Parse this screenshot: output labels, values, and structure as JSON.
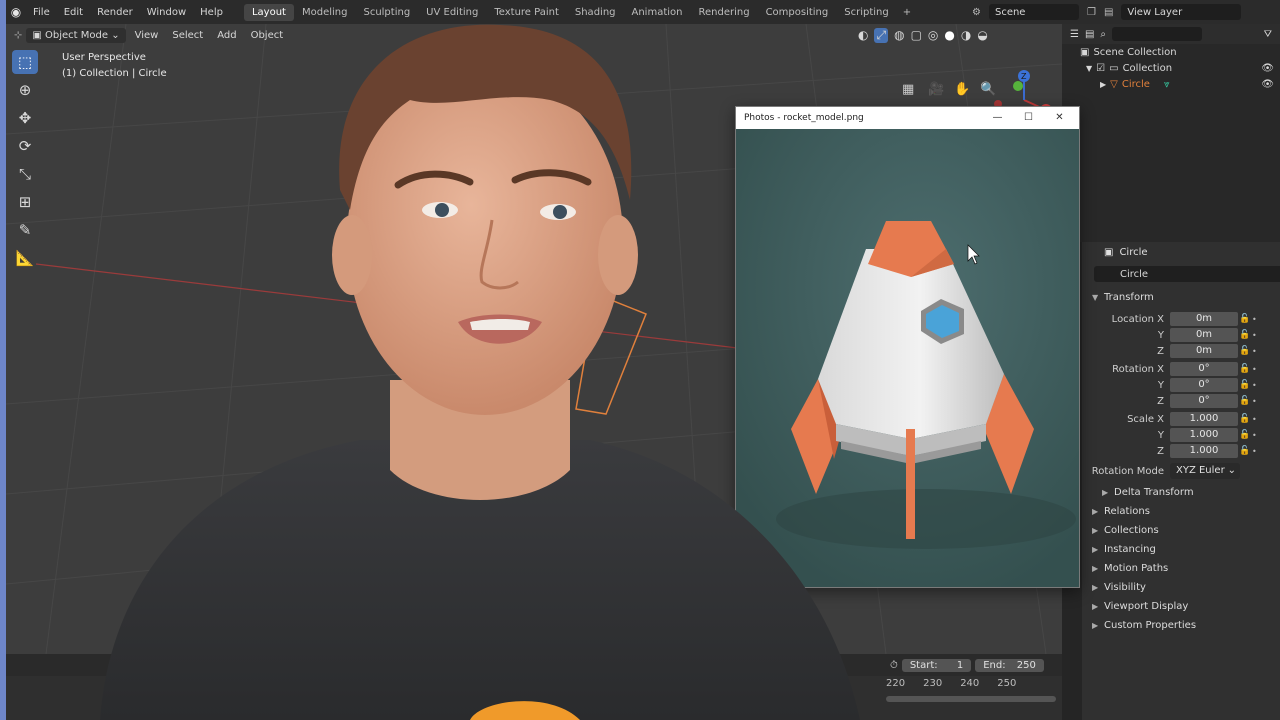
{
  "app": {
    "menu": [
      "File",
      "Edit",
      "Render",
      "Window",
      "Help"
    ],
    "workspaces": [
      "Layout",
      "Modeling",
      "Sculpting",
      "UV Editing",
      "Texture Paint",
      "Shading",
      "Animation",
      "Rendering",
      "Compositing",
      "Scripting"
    ],
    "active_workspace": "Layout",
    "add_workspace": "+",
    "scene": "Scene",
    "view_layer": "View Layer"
  },
  "viewport": {
    "mode": "Object Mode",
    "menus": [
      "View",
      "Select",
      "Add",
      "Object"
    ],
    "perspective": "User Perspective",
    "collection_info": "(1) Collection | Circle",
    "gizmo": {
      "x": "X",
      "y": "Y",
      "z": "Z"
    }
  },
  "outliner": {
    "scene_collection": "Scene Collection",
    "collection": "Collection",
    "object": "Circle"
  },
  "properties": {
    "object_name": "Circle",
    "field_name": "Circle",
    "transform_title": "Transform",
    "location": {
      "label_x": "Location X",
      "label_y": "Y",
      "label_z": "Z",
      "x": "0m",
      "y": "0m",
      "z": "0m"
    },
    "rotation": {
      "label_x": "Rotation X",
      "label_y": "Y",
      "label_z": "Z",
      "x": "0°",
      "y": "0°",
      "z": "0°"
    },
    "scale": {
      "label_x": "Scale X",
      "label_y": "Y",
      "label_z": "Z",
      "x": "1.000",
      "y": "1.000",
      "z": "1.000"
    },
    "rotation_mode_label": "Rotation Mode",
    "rotation_mode": "XYZ Euler",
    "delta_transform": "Delta Transform",
    "sections": [
      "Relations",
      "Collections",
      "Instancing",
      "Motion Paths",
      "Visibility",
      "Viewport Display",
      "Custom Properties"
    ]
  },
  "timeline": {
    "start_label": "Start:",
    "start": "1",
    "end_label": "End:",
    "end": "250",
    "ruler": [
      "220",
      "230",
      "240",
      "250"
    ]
  },
  "photos_window": {
    "title": "Photos - rocket_model.png",
    "minimize": "—",
    "maximize": "☐",
    "close": "✕"
  },
  "colors": {
    "accent": "#4772b3",
    "object_orange": "#e0803c",
    "photo_bg": "#3f5d5e",
    "rocket_body": "#e6e6e6",
    "rocket_orange": "#e67a4f",
    "window_blue": "#4aa3d8"
  },
  "icons": {
    "toolbar": [
      "select-box-icon",
      "cursor-icon",
      "move-icon",
      "rotate-icon",
      "scale-icon",
      "transform-icon",
      "annotate-icon",
      "measure-icon"
    ]
  }
}
